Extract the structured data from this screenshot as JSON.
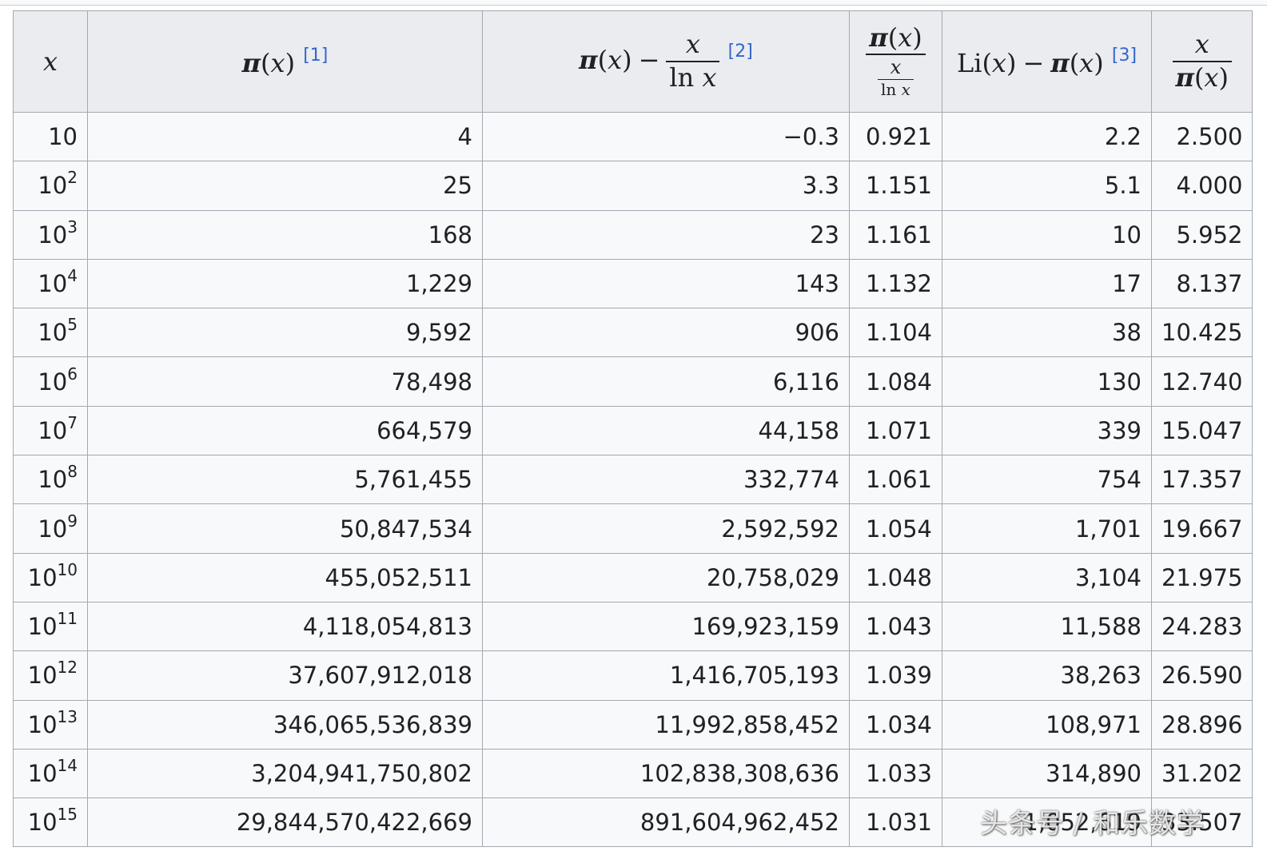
{
  "table": {
    "header": {
      "x": "x",
      "pi": "π",
      "lparen": "(",
      "rparen": ")",
      "minus": "−",
      "ln": "ln",
      "li": "Li",
      "refs": [
        "[1]",
        "[2]",
        "[3]"
      ]
    },
    "rows": [
      {
        "base": "10",
        "exp": "",
        "pi": "4",
        "diff": "−0.3",
        "ratio": "0.921",
        "li_diff": "2.2",
        "x_over_pi": "2.500"
      },
      {
        "base": "10",
        "exp": "2",
        "pi": "25",
        "diff": "3.3",
        "ratio": "1.151",
        "li_diff": "5.1",
        "x_over_pi": "4.000"
      },
      {
        "base": "10",
        "exp": "3",
        "pi": "168",
        "diff": "23",
        "ratio": "1.161",
        "li_diff": "10",
        "x_over_pi": "5.952"
      },
      {
        "base": "10",
        "exp": "4",
        "pi": "1,229",
        "diff": "143",
        "ratio": "1.132",
        "li_diff": "17",
        "x_over_pi": "8.137"
      },
      {
        "base": "10",
        "exp": "5",
        "pi": "9,592",
        "diff": "906",
        "ratio": "1.104",
        "li_diff": "38",
        "x_over_pi": "10.425"
      },
      {
        "base": "10",
        "exp": "6",
        "pi": "78,498",
        "diff": "6,116",
        "ratio": "1.084",
        "li_diff": "130",
        "x_over_pi": "12.740"
      },
      {
        "base": "10",
        "exp": "7",
        "pi": "664,579",
        "diff": "44,158",
        "ratio": "1.071",
        "li_diff": "339",
        "x_over_pi": "15.047"
      },
      {
        "base": "10",
        "exp": "8",
        "pi": "5,761,455",
        "diff": "332,774",
        "ratio": "1.061",
        "li_diff": "754",
        "x_over_pi": "17.357"
      },
      {
        "base": "10",
        "exp": "9",
        "pi": "50,847,534",
        "diff": "2,592,592",
        "ratio": "1.054",
        "li_diff": "1,701",
        "x_over_pi": "19.667"
      },
      {
        "base": "10",
        "exp": "10",
        "pi": "455,052,511",
        "diff": "20,758,029",
        "ratio": "1.048",
        "li_diff": "3,104",
        "x_over_pi": "21.975"
      },
      {
        "base": "10",
        "exp": "11",
        "pi": "4,118,054,813",
        "diff": "169,923,159",
        "ratio": "1.043",
        "li_diff": "11,588",
        "x_over_pi": "24.283"
      },
      {
        "base": "10",
        "exp": "12",
        "pi": "37,607,912,018",
        "diff": "1,416,705,193",
        "ratio": "1.039",
        "li_diff": "38,263",
        "x_over_pi": "26.590"
      },
      {
        "base": "10",
        "exp": "13",
        "pi": "346,065,536,839",
        "diff": "11,992,858,452",
        "ratio": "1.034",
        "li_diff": "108,971",
        "x_over_pi": "28.896"
      },
      {
        "base": "10",
        "exp": "14",
        "pi": "3,204,941,750,802",
        "diff": "102,838,308,636",
        "ratio": "1.033",
        "li_diff": "314,890",
        "x_over_pi": "31.202"
      },
      {
        "base": "10",
        "exp": "15",
        "pi": "29,844,570,422,669",
        "diff": "891,604,962,452",
        "ratio": "1.031",
        "li_diff": "1,052,619",
        "x_over_pi": "33.507"
      }
    ]
  },
  "watermark": "头条号 / 和乐数学",
  "colors": {
    "header_bg": "#eaecf0",
    "cell_bg": "#f8f9fa",
    "border": "#a2a9b1",
    "ref_link": "#3366cc"
  }
}
